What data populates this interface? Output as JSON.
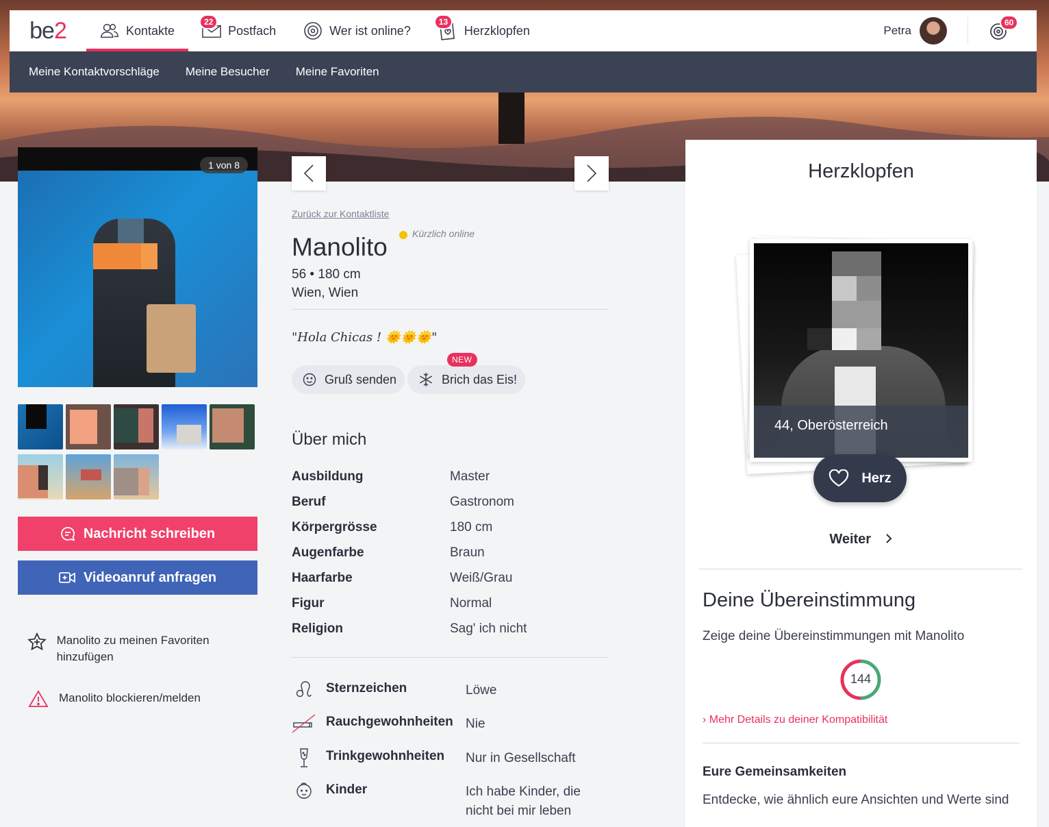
{
  "nav": {
    "logo_text": "be",
    "logo_accent": "2",
    "items": [
      {
        "label": "Kontakte",
        "icon": "contacts-icon",
        "badge": null,
        "active": true
      },
      {
        "label": "Postfach",
        "icon": "mail-icon",
        "badge": "22",
        "active": false
      },
      {
        "label": "Wer ist online?",
        "icon": "online-icon",
        "badge": null,
        "active": false
      },
      {
        "label": "Herzklopfen",
        "icon": "heartbeat-icon",
        "badge": "13",
        "active": false
      }
    ],
    "user_name": "Petra",
    "notifications_badge": "60"
  },
  "subnav": {
    "items": [
      "Meine Kontaktvorschläge",
      "Meine Besucher",
      "Meine Favoriten"
    ]
  },
  "gallery": {
    "counter": "1 von 8"
  },
  "actions": {
    "message_label": "Nachricht schreiben",
    "video_label": "Videoanruf anfragen",
    "favorite_label": "Manolito zu meinen Favoriten hinzufügen",
    "block_label": "Manolito blockieren/melden"
  },
  "profile": {
    "back_link": "Zurück zur Kontaktliste",
    "name": "Manolito",
    "online_status": "Kürzlich online",
    "age_height": "56 • 180 cm",
    "location": "Wien, Wien",
    "quote": "\"Hola Chicas ! 🌞🌞🌞\"",
    "greet_label": "Gruß senden",
    "icebreaker_label": "Brich das Eis!",
    "new_badge": "NEW"
  },
  "about": {
    "title": "Über mich",
    "attributes": [
      {
        "label": "Ausbildung",
        "value": "Master"
      },
      {
        "label": "Beruf",
        "value": "Gastronom"
      },
      {
        "label": "Körpergrösse",
        "value": "180 cm"
      },
      {
        "label": "Augenfarbe",
        "value": "Braun"
      },
      {
        "label": "Haarfarbe",
        "value": "Weiß/Grau"
      },
      {
        "label": "Figur",
        "value": "Normal"
      },
      {
        "label": "Religion",
        "value": "Sag' ich nicht"
      }
    ],
    "lifestyle": [
      {
        "label": "Sternzeichen",
        "value": "Löwe",
        "icon": "zodiac-leo-icon"
      },
      {
        "label": "Rauchgewohnheiten",
        "value": "Nie",
        "icon": "no-smoking-icon"
      },
      {
        "label": "Trinkgewohnheiten",
        "value": "Nur in Gesellschaft",
        "icon": "wine-glass-icon"
      },
      {
        "label": "Kinder",
        "value": "Ich habe Kinder, die nicht bei mir leben",
        "icon": "baby-icon"
      }
    ]
  },
  "herzklopfen": {
    "title": "Herzklopfen",
    "card_caption": "44, Oberösterreich",
    "heart_label": "Herz",
    "next_label": "Weiter"
  },
  "match": {
    "title": "Deine Übereinstimmung",
    "subtitle": "Zeige deine Übereinstimmungen mit Manolito",
    "score": "144",
    "more_link": "Mehr Details zu deiner Kompatibilität",
    "common_title": "Eure Gemeinsamkeiten",
    "common_text": "Entdecke, wie ähnlich eure Ansichten und Werte sind"
  },
  "colors": {
    "accent": "#e8315d",
    "video": "#4064b7",
    "subnav": "#3b4254"
  }
}
